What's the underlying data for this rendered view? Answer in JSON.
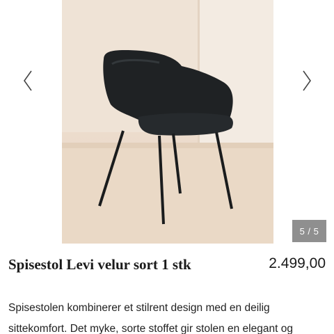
{
  "gallery": {
    "image_alt": "Spisestol Levi velur sort",
    "prev_icon": "chevron-left-icon",
    "next_icon": "chevron-right-icon",
    "counter": "5 / 5",
    "counter_bg": "#8f8f8f"
  },
  "product": {
    "title": "Spisestol Levi velur sort 1 stk",
    "price": "2.499,00",
    "description_lines": [
      "Spisestolen kombinerer et stilrent design med en deilig",
      "sittekomfort. Det myke, sorte stoffet gir stolen en elegant og"
    ]
  }
}
